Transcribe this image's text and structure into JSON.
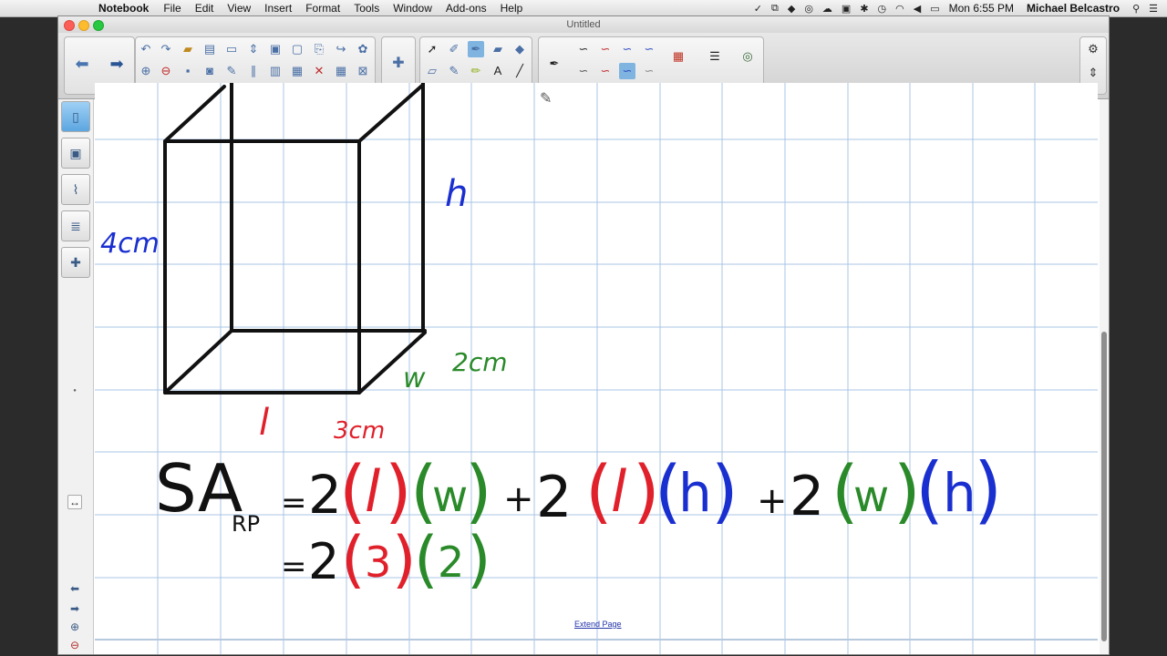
{
  "menubar": {
    "app_name": "Notebook",
    "items": [
      "File",
      "Edit",
      "View",
      "Insert",
      "Format",
      "Tools",
      "Window",
      "Add-ons",
      "Help"
    ],
    "clock": "Mon 6:55 PM",
    "user": "Michael Belcastro"
  },
  "window": {
    "title": "Untitled"
  },
  "canvas": {
    "labels": {
      "height_var": "h",
      "height_value": "4cm",
      "width_var": "w",
      "width_value": "2cm",
      "length_var": "l",
      "length_value": "3cm"
    },
    "formula_line1": {
      "lhs": "SA",
      "lhs_sub": "RP",
      "eq": "=",
      "two1": "2",
      "l1": "l",
      "w1": "w",
      "plus1": "+",
      "two2": "2",
      "l2": "l",
      "h1": "h",
      "plus2": "+",
      "two3": "2",
      "w2": "w",
      "h2": "h"
    },
    "formula_line2": {
      "eq": "=",
      "two": "2",
      "three": "3",
      "twov": "2"
    },
    "extend_page": "Extend Page"
  },
  "colors": {
    "blue_ink": "#1a2fd0",
    "red_ink": "#e0202a",
    "green_ink": "#2a8a2a",
    "grid": "#a9c4e4"
  }
}
